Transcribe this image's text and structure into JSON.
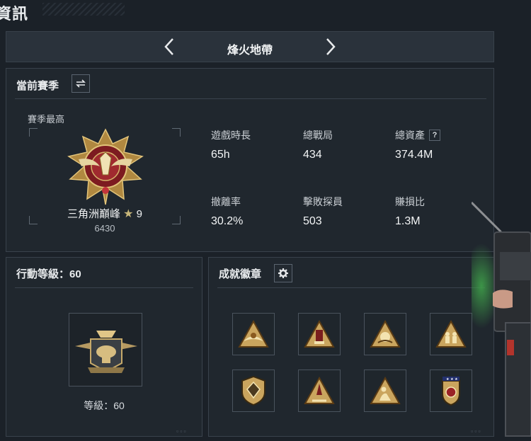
{
  "page": {
    "title": "資訊"
  },
  "mode_nav": {
    "current_mode": "烽火地帶"
  },
  "season": {
    "header": "當前賽季",
    "best_label": "賽季最高",
    "rank_name": "三角洲巔峰",
    "rank_stars": "9",
    "rank_score": "6430",
    "stats": [
      {
        "label": "遊戲時長",
        "value": "65h"
      },
      {
        "label": "總戰局",
        "value": "434"
      },
      {
        "label": "總資產",
        "value": "374.4M",
        "help": "?"
      },
      {
        "label": "撤離率",
        "value": "30.2%"
      },
      {
        "label": "擊敗探員",
        "value": "503"
      },
      {
        "label": "賺損比",
        "value": "1.3M"
      }
    ]
  },
  "operation_level": {
    "header": "行動等級：60",
    "caption": "等級：60"
  },
  "achievements": {
    "header": "成就徽章",
    "badges": [
      "eagle-triangle-badge",
      "tower-triangle-badge",
      "crest-triangle-badge",
      "soldiers-triangle-badge",
      "shield-badge",
      "rocket-triangle-badge",
      "figure-triangle-badge",
      "flag-shield-badge"
    ]
  },
  "colors": {
    "gold": "#c9a25a",
    "crimson": "#8c1f24",
    "panel": "#20272e",
    "border": "#39424c"
  }
}
